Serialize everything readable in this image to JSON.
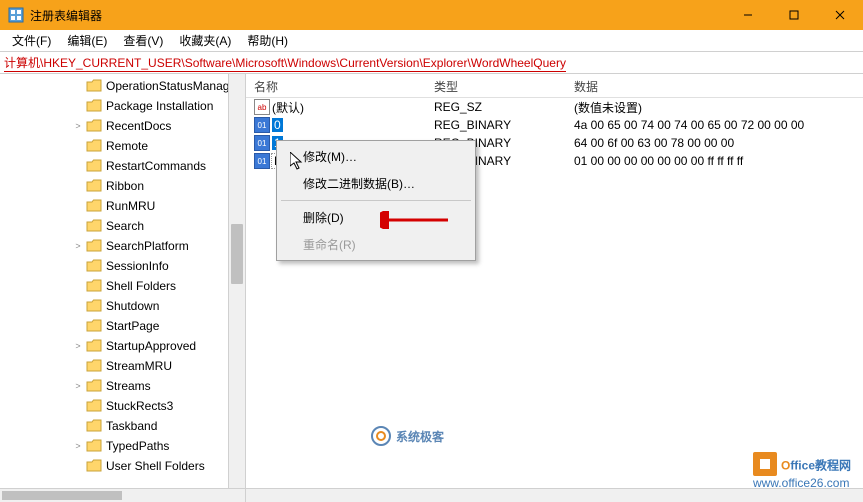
{
  "window": {
    "title": "注册表编辑器"
  },
  "menu": {
    "file": "文件(F)",
    "edit": "编辑(E)",
    "view": "查看(V)",
    "favorites": "收藏夹(A)",
    "help": "帮助(H)"
  },
  "address": {
    "path": "计算机\\HKEY_CURRENT_USER\\Software\\Microsoft\\Windows\\CurrentVersion\\Explorer\\WordWheelQuery"
  },
  "tree": {
    "items": [
      {
        "level": 2,
        "exp": "",
        "label": "OperationStatusManag"
      },
      {
        "level": 2,
        "exp": "",
        "label": "Package Installation"
      },
      {
        "level": 2,
        "exp": ">",
        "label": "RecentDocs"
      },
      {
        "level": 2,
        "exp": "",
        "label": "Remote"
      },
      {
        "level": 2,
        "exp": "",
        "label": "RestartCommands"
      },
      {
        "level": 2,
        "exp": "",
        "label": "Ribbon"
      },
      {
        "level": 2,
        "exp": "",
        "label": "RunMRU"
      },
      {
        "level": 2,
        "exp": "",
        "label": "Search"
      },
      {
        "level": 2,
        "exp": ">",
        "label": "SearchPlatform"
      },
      {
        "level": 2,
        "exp": "",
        "label": "SessionInfo"
      },
      {
        "level": 2,
        "exp": "",
        "label": "Shell Folders"
      },
      {
        "level": 2,
        "exp": "",
        "label": "Shutdown"
      },
      {
        "level": 2,
        "exp": "",
        "label": "StartPage"
      },
      {
        "level": 2,
        "exp": ">",
        "label": "StartupApproved"
      },
      {
        "level": 2,
        "exp": "",
        "label": "StreamMRU"
      },
      {
        "level": 2,
        "exp": ">",
        "label": "Streams"
      },
      {
        "level": 2,
        "exp": "",
        "label": "StuckRects3"
      },
      {
        "level": 2,
        "exp": "",
        "label": "Taskband"
      },
      {
        "level": 2,
        "exp": ">",
        "label": "TypedPaths"
      },
      {
        "level": 2,
        "exp": "",
        "label": "User Shell Folders"
      }
    ]
  },
  "columns": {
    "name": "名称",
    "type": "类型",
    "data": "数据"
  },
  "values": [
    {
      "icon": "str",
      "name": "(默认)",
      "type": "REG_SZ",
      "data": "(数值未设置)",
      "sel": false
    },
    {
      "icon": "bin",
      "name": "0",
      "type": "REG_BINARY",
      "data": "4a 00 65 00 74 00 74 00 65 00 72 00 00 00",
      "sel": true
    },
    {
      "icon": "bin",
      "name": "1",
      "type": "REG_BINARY",
      "data": "64 00 6f 00 63 00 78 00 00 00",
      "sel": true,
      "focus": true
    },
    {
      "icon": "bin",
      "name": "MRUListEx",
      "type": "REG_BINARY",
      "data": "01 00 00 00 00 00 00 00 ff ff ff ff",
      "sel": false,
      "focusbox": true
    }
  ],
  "contextMenu": {
    "modify": "修改(M)…",
    "modifyBinary": "修改二进制数据(B)…",
    "delete": "删除(D)",
    "rename": "重命名(R)"
  },
  "watermarks": {
    "w1": "系统极客",
    "w2_brand": "Office教程网",
    "w2_url": "www.office26.com"
  }
}
